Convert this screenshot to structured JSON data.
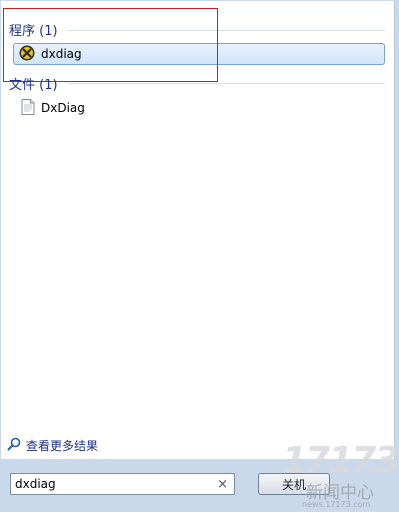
{
  "sections": {
    "programs": {
      "header": "程序 (1)",
      "items": [
        {
          "label": "dxdiag"
        }
      ]
    },
    "files": {
      "header": "文件 (1)",
      "items": [
        {
          "label": "DxDiag"
        }
      ]
    }
  },
  "more_results": {
    "label": "查看更多结果"
  },
  "search": {
    "value": "dxdiag",
    "clear": "×"
  },
  "shutdown": {
    "label": "关机"
  },
  "watermark": {
    "big": "17173",
    "cn": "新闻中心",
    "url": "news.17173.com"
  },
  "colors": {
    "accent": "#1e3287",
    "highlight_border": "#7da2ce",
    "annotation": "#c81e1e"
  }
}
